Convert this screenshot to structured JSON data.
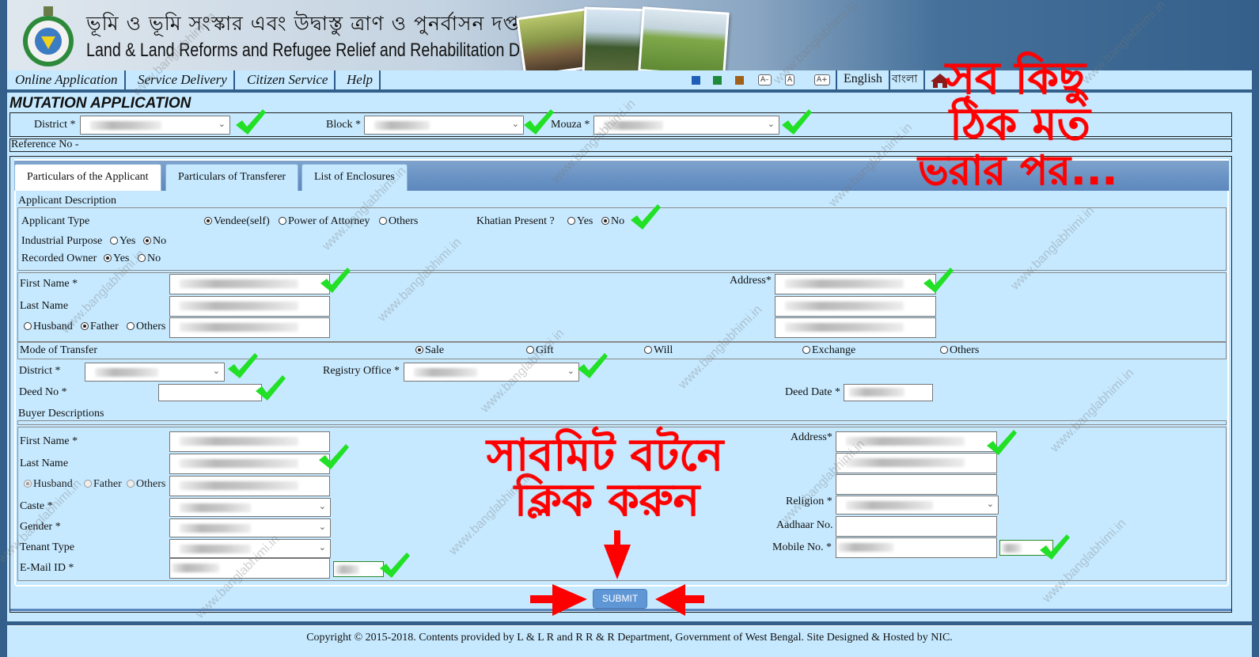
{
  "header": {
    "title_bengali": "ভূমি ও ভূমি সংস্কার এবং উদ্বাস্তু ত্রাণ ও পুনর্বাসন দপ্তর",
    "title_english": "Land & Land Reforms and Refugee Relief and Rehabilitation Department"
  },
  "nav": {
    "items": [
      {
        "label": "Online Application"
      },
      {
        "label": "Service Delivery"
      },
      {
        "label": "Citizen Service"
      },
      {
        "label": "Help"
      }
    ],
    "theme_colors": [
      "#1f5fb8",
      "#1f8a3a",
      "#a0601a"
    ],
    "font_buttons": [
      "A–",
      "A",
      "A+"
    ],
    "languages": [
      "English",
      "বাংলা"
    ]
  },
  "page": {
    "title": "MUTATION APPLICATION",
    "location": {
      "district_label": "District *",
      "block_label": "Block *",
      "mouza_label": "Mouza *"
    },
    "reference_label": "Reference No -"
  },
  "tabs": [
    {
      "label": "Particulars of the Applicant",
      "active": true
    },
    {
      "label": "Particulars of Transferer",
      "active": false
    },
    {
      "label": "List of Enclosures",
      "active": false
    }
  ],
  "applicant": {
    "section_label": "Applicant Description",
    "type_label": "Applicant Type",
    "type_options": [
      "Vendee(self)",
      "Power of Attorney",
      "Others"
    ],
    "type_selected": "Vendee(self)",
    "khatian_label": "Khatian Present ?",
    "khatian_options": [
      "Yes",
      "No"
    ],
    "khatian_selected": "No",
    "industrial_label": "Industrial Purpose",
    "industrial_options": [
      "Yes",
      "No"
    ],
    "industrial_selected": "No",
    "recorded_label": "Recorded Owner",
    "recorded_options": [
      "Yes",
      "No"
    ],
    "recorded_selected": "Yes",
    "first_name_label": "First Name *",
    "last_name_label": "Last Name",
    "relation_options": [
      "Husband",
      "Father",
      "Others"
    ],
    "relation_selected": "Father",
    "address_label": "Address*",
    "blurred_text": "your dat is here fg ehkfg"
  },
  "transfer": {
    "mode_label": "Mode of Transfer",
    "mode_options": [
      "Sale",
      "Gift",
      "Will",
      "Exchange",
      "Others"
    ],
    "mode_selected": "Sale",
    "district_label": "District *",
    "registry_label": "Registry Office *",
    "deed_no_label": "Deed No *",
    "deed_date_label": "Deed Date *"
  },
  "buyer": {
    "section_label": "Buyer Descriptions",
    "first_name_label": "First Name *",
    "last_name_label": "Last Name",
    "relation_options": [
      "Husband",
      "Father",
      "Others"
    ],
    "relation_selected": "Husband",
    "caste_label": "Caste *",
    "gender_label": "Gender *",
    "tenant_label": "Tenant Type",
    "email_label": "E-Mail ID *",
    "address_label": "Address*",
    "religion_label": "Religion *",
    "aadhaar_label": "Aadhaar No.",
    "mobile_label": "Mobile No. *"
  },
  "submit_label": "SUBMIT",
  "footer": {
    "copyright": "Copyright © 2015-2018. Contents provided by L & L R and R R & R Department, Government of West Bengal. Site Designed & Hosted by NIC."
  },
  "annotations": {
    "top_right_lines": [
      "সব কিছু",
      "ঠিক মত",
      "ভরার পর..."
    ],
    "center_lines": [
      "সাবমিট বটনে",
      "ক্লিক করুন"
    ],
    "watermark": "www.banglabhimi.in",
    "color": "#ff0000"
  }
}
